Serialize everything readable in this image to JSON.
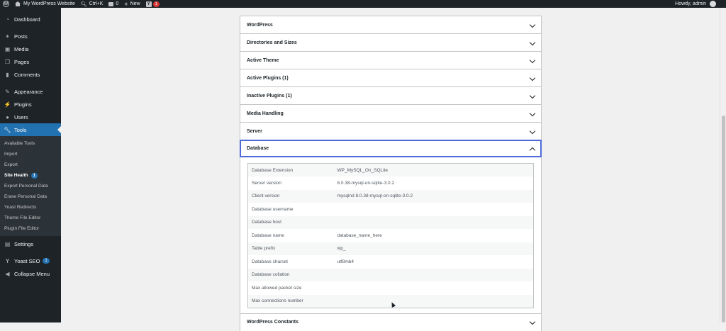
{
  "adminbar": {
    "site_name": "My WordPress Website",
    "search_shortcut": "Ctrl+K",
    "comments_count": "0",
    "new_label": "New",
    "yoast_count": "1",
    "howdy": "Howdy, admin"
  },
  "sidebar": {
    "items": [
      {
        "label": "Dashboard",
        "icon": "dashboard-icon"
      },
      {
        "label": "Posts",
        "icon": "pin-icon"
      },
      {
        "label": "Media",
        "icon": "media-icon"
      },
      {
        "label": "Pages",
        "icon": "pages-icon"
      },
      {
        "label": "Comments",
        "icon": "comments-icon"
      },
      {
        "label": "Appearance",
        "icon": "brush-icon"
      },
      {
        "label": "Plugins",
        "icon": "plug-icon"
      },
      {
        "label": "Users",
        "icon": "user-icon"
      },
      {
        "label": "Tools",
        "icon": "wrench-icon"
      },
      {
        "label": "Settings",
        "icon": "settings-icon"
      },
      {
        "label": "Yoast SEO",
        "icon": "yoast-icon",
        "badge": "1"
      },
      {
        "label": "Collapse Menu",
        "icon": "collapse-icon"
      }
    ],
    "tools_submenu": [
      {
        "label": "Available Tools"
      },
      {
        "label": "Import"
      },
      {
        "label": "Export"
      },
      {
        "label": "Site Health",
        "badge": "1"
      },
      {
        "label": "Export Personal Data"
      },
      {
        "label": "Erase Personal Data"
      },
      {
        "label": "Yoast Redirects"
      },
      {
        "label": "Theme File Editor"
      },
      {
        "label": "Plugin File Editor"
      }
    ]
  },
  "sections": [
    "WordPress",
    "Directories and Sizes",
    "Active Theme",
    "Active Plugins (1)",
    "Inactive Plugins (1)",
    "Media Handling",
    "Server",
    "Database",
    "WordPress Constants"
  ],
  "database": {
    "rows": [
      {
        "key": "Database Extension",
        "value": "WP_MySQL_On_SQLite"
      },
      {
        "key": "Server version",
        "value": "8.0.38-mysql-on-sqlite-3.0.2"
      },
      {
        "key": "Client version",
        "value": "mysqlnd 8.0.38-mysql-on-sqlite-3.0.2"
      },
      {
        "key": "Database username",
        "value": ""
      },
      {
        "key": "Database host",
        "value": ""
      },
      {
        "key": "Database name",
        "value": "database_name_here"
      },
      {
        "key": "Table prefix",
        "value": "wp_"
      },
      {
        "key": "Database charset",
        "value": "utf8mb4"
      },
      {
        "key": "Database collation",
        "value": ""
      },
      {
        "key": "Max allowed packet size",
        "value": ""
      },
      {
        "key": "Max connections number",
        "value": ""
      }
    ]
  },
  "colors": {
    "admin_dark": "#1d2327",
    "accent": "#2271b1",
    "focus_border": "#4f6bd8",
    "notification": "#d63638"
  }
}
